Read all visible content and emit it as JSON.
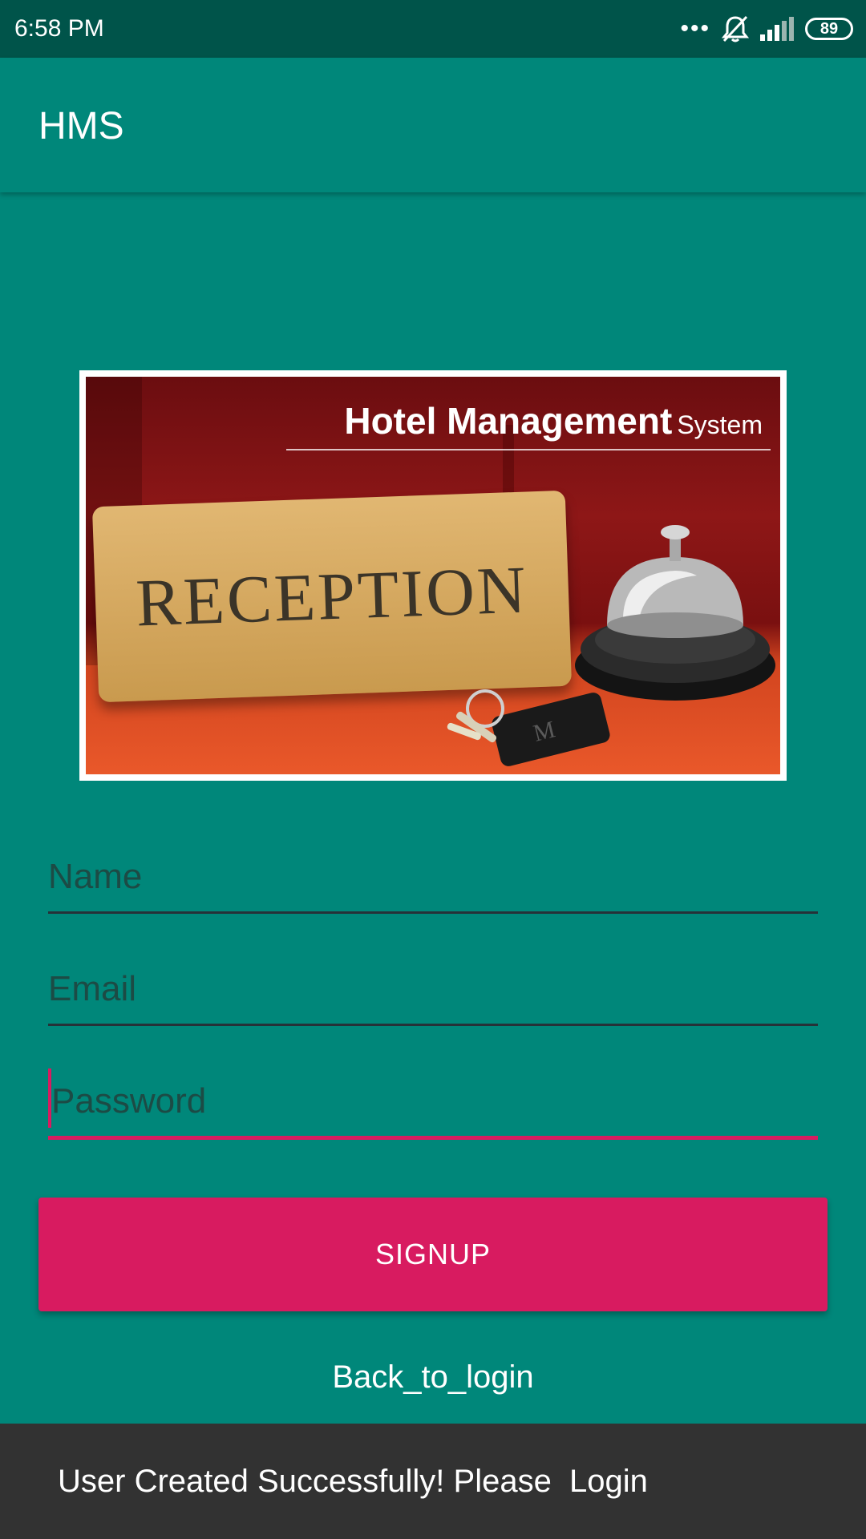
{
  "status_bar": {
    "time": "6:58 PM",
    "battery": "89",
    "icons": [
      "more-dots-icon",
      "notifications-off-icon",
      "signal-icon",
      "battery-icon"
    ]
  },
  "app_bar": {
    "title": "HMS"
  },
  "banner": {
    "title_main": "Hotel Management",
    "title_sub": "System",
    "sign_text": "RECEPTION",
    "key_tag_letter": "M"
  },
  "form": {
    "name": {
      "value": "",
      "placeholder": "Name"
    },
    "email": {
      "value": "",
      "placeholder": "Email"
    },
    "password": {
      "value": "",
      "placeholder": "Password"
    },
    "signup_label": "SIGNUP",
    "back_link": "Back_to_login"
  },
  "snackbar": {
    "message": "User Created Successfully! Please  Login"
  },
  "colors": {
    "primary": "#00877A",
    "primary_dark": "#00544A",
    "accent": "#D81B60",
    "snackbar_bg": "#323232"
  }
}
